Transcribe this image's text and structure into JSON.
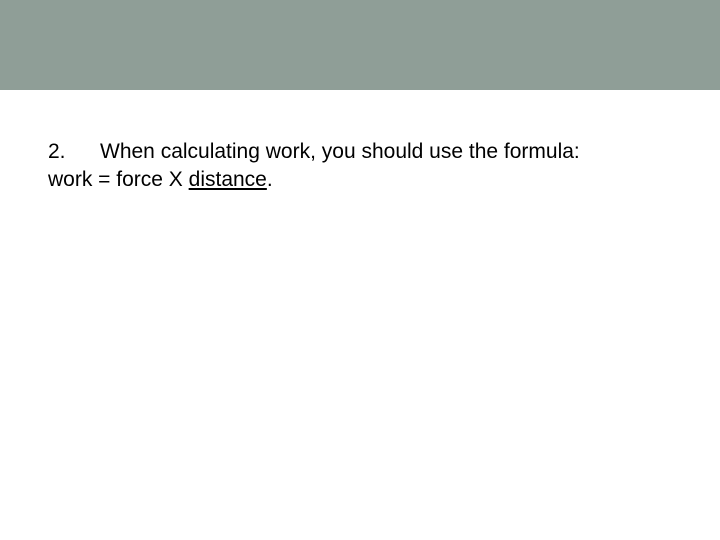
{
  "question": {
    "number": "2.",
    "line1": "When calculating work, you should use the formula:",
    "line2_prefix": "work = force X ",
    "line2_underlined": "distance",
    "line2_suffix": "."
  }
}
